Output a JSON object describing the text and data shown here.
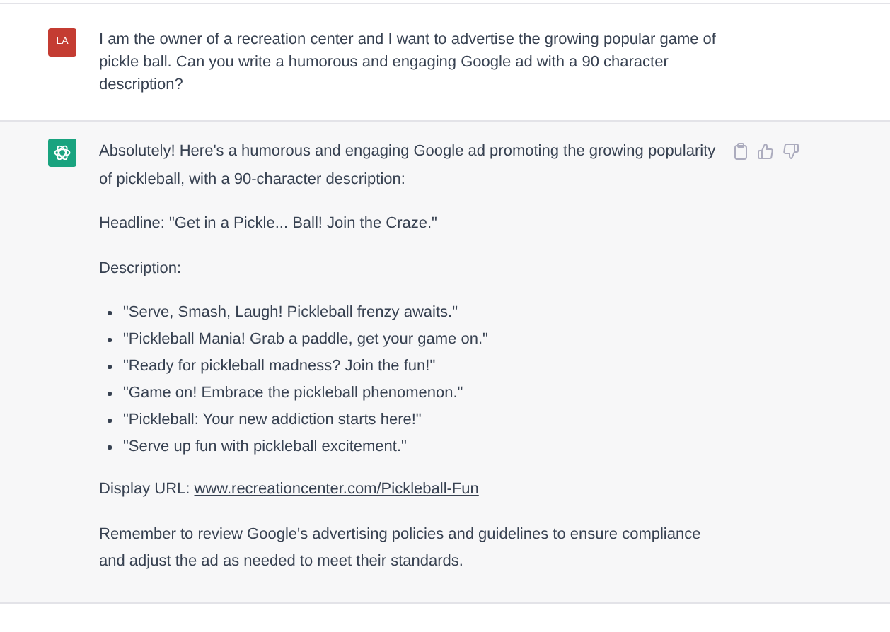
{
  "messages": [
    {
      "kind": "user",
      "avatar": "LA",
      "blocks": [
        {
          "kind": "paragraph",
          "text": "I am the owner of a recreation center and I want to advertise the growing popular game of pickle ball. Can you write a humorous and engaging Google ad with a 90 character description?"
        }
      ]
    },
    {
      "kind": "assistant",
      "blocks": [
        {
          "kind": "paragraph",
          "text": "Absolutely! Here's a humorous and engaging Google ad promoting the growing popularity of pickleball, with a 90-character description:"
        },
        {
          "kind": "paragraph",
          "text": "Headline: \"Get in a Pickle... Ball! Join the Craze.\""
        },
        {
          "kind": "paragraph",
          "text": "Description:"
        },
        {
          "kind": "list",
          "items": [
            "\"Serve, Smash, Laugh! Pickleball frenzy awaits.\"",
            "\"Pickleball Mania! Grab a paddle, get your game on.\"",
            "\"Ready for pickleball madness? Join the fun!\"",
            "\"Game on! Embrace the pickleball phenomenon.\"",
            "\"Pickleball: Your new addiction starts here!\"",
            "\"Serve up fun with pickleball excitement.\""
          ]
        },
        {
          "kind": "link_line",
          "label": "Display URL:",
          "link": "www.recreationcenter.com/Pickleball-Fun"
        },
        {
          "kind": "paragraph",
          "text": "Remember to review Google's advertising policies and guidelines to ensure compliance and adjust the ad as needed to meet their standards."
        }
      ]
    }
  ]
}
